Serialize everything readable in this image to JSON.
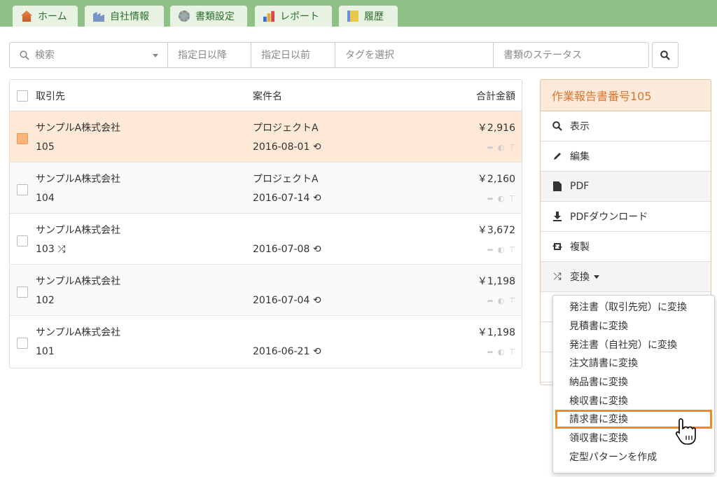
{
  "nav": {
    "tabs": [
      {
        "label": "ホーム",
        "icon": "home-icon"
      },
      {
        "label": "自社情報",
        "icon": "company-icon"
      },
      {
        "label": "書類設定",
        "icon": "gear-icon"
      },
      {
        "label": "レポート",
        "icon": "bar-chart-icon"
      },
      {
        "label": "履歴",
        "icon": "history-icon"
      }
    ]
  },
  "search": {
    "keyword_placeholder": "検索",
    "date_from_placeholder": "指定日以降",
    "date_to_placeholder": "指定日以前",
    "tag_placeholder": "タグを選択",
    "status_placeholder": "書類のステータス"
  },
  "table": {
    "headers": {
      "client": "取引先",
      "project": "案件名",
      "total": "合計金額"
    },
    "rows": [
      {
        "client": "サンプルA株式会社",
        "number": "105",
        "project": "プロジェクトA",
        "date": "2016-08-01",
        "amount": "￥2,916"
      },
      {
        "client": "サンプルA株式会社",
        "number": "104",
        "project": "プロジェクトA",
        "date": "2016-07-14",
        "amount": "￥2,160"
      },
      {
        "client": "サンプルA株式会社",
        "number": "103",
        "project": "",
        "date": "2016-07-08",
        "amount": "￥3,672"
      },
      {
        "client": "サンプルA株式会社",
        "number": "102",
        "project": "",
        "date": "2016-07-04",
        "amount": "￥1,198"
      },
      {
        "client": "サンプルA株式会社",
        "number": "101",
        "project": "",
        "date": "2016-06-21",
        "amount": "￥1,198"
      }
    ]
  },
  "panel": {
    "title": "作業報告書番号105",
    "items": {
      "view": "表示",
      "edit": "編集",
      "pdf": "PDF",
      "pdf_download": "PDFダウンロード",
      "duplicate": "複製",
      "convert": "変換"
    }
  },
  "convert_menu": {
    "items": [
      "発注書（取引先宛）に変換",
      "見積書に変換",
      "発注書（自社宛）に変換",
      "注文請書に変換",
      "納品書に変換",
      "検収書に変換",
      "請求書に変換",
      "領収書に変換",
      "定型パターンを作成"
    ]
  },
  "colors": {
    "nav_bg": "#8fc187",
    "selected_row": "#fde9d6",
    "panel_accent": "#d9762e",
    "highlight": "#f08a24"
  }
}
